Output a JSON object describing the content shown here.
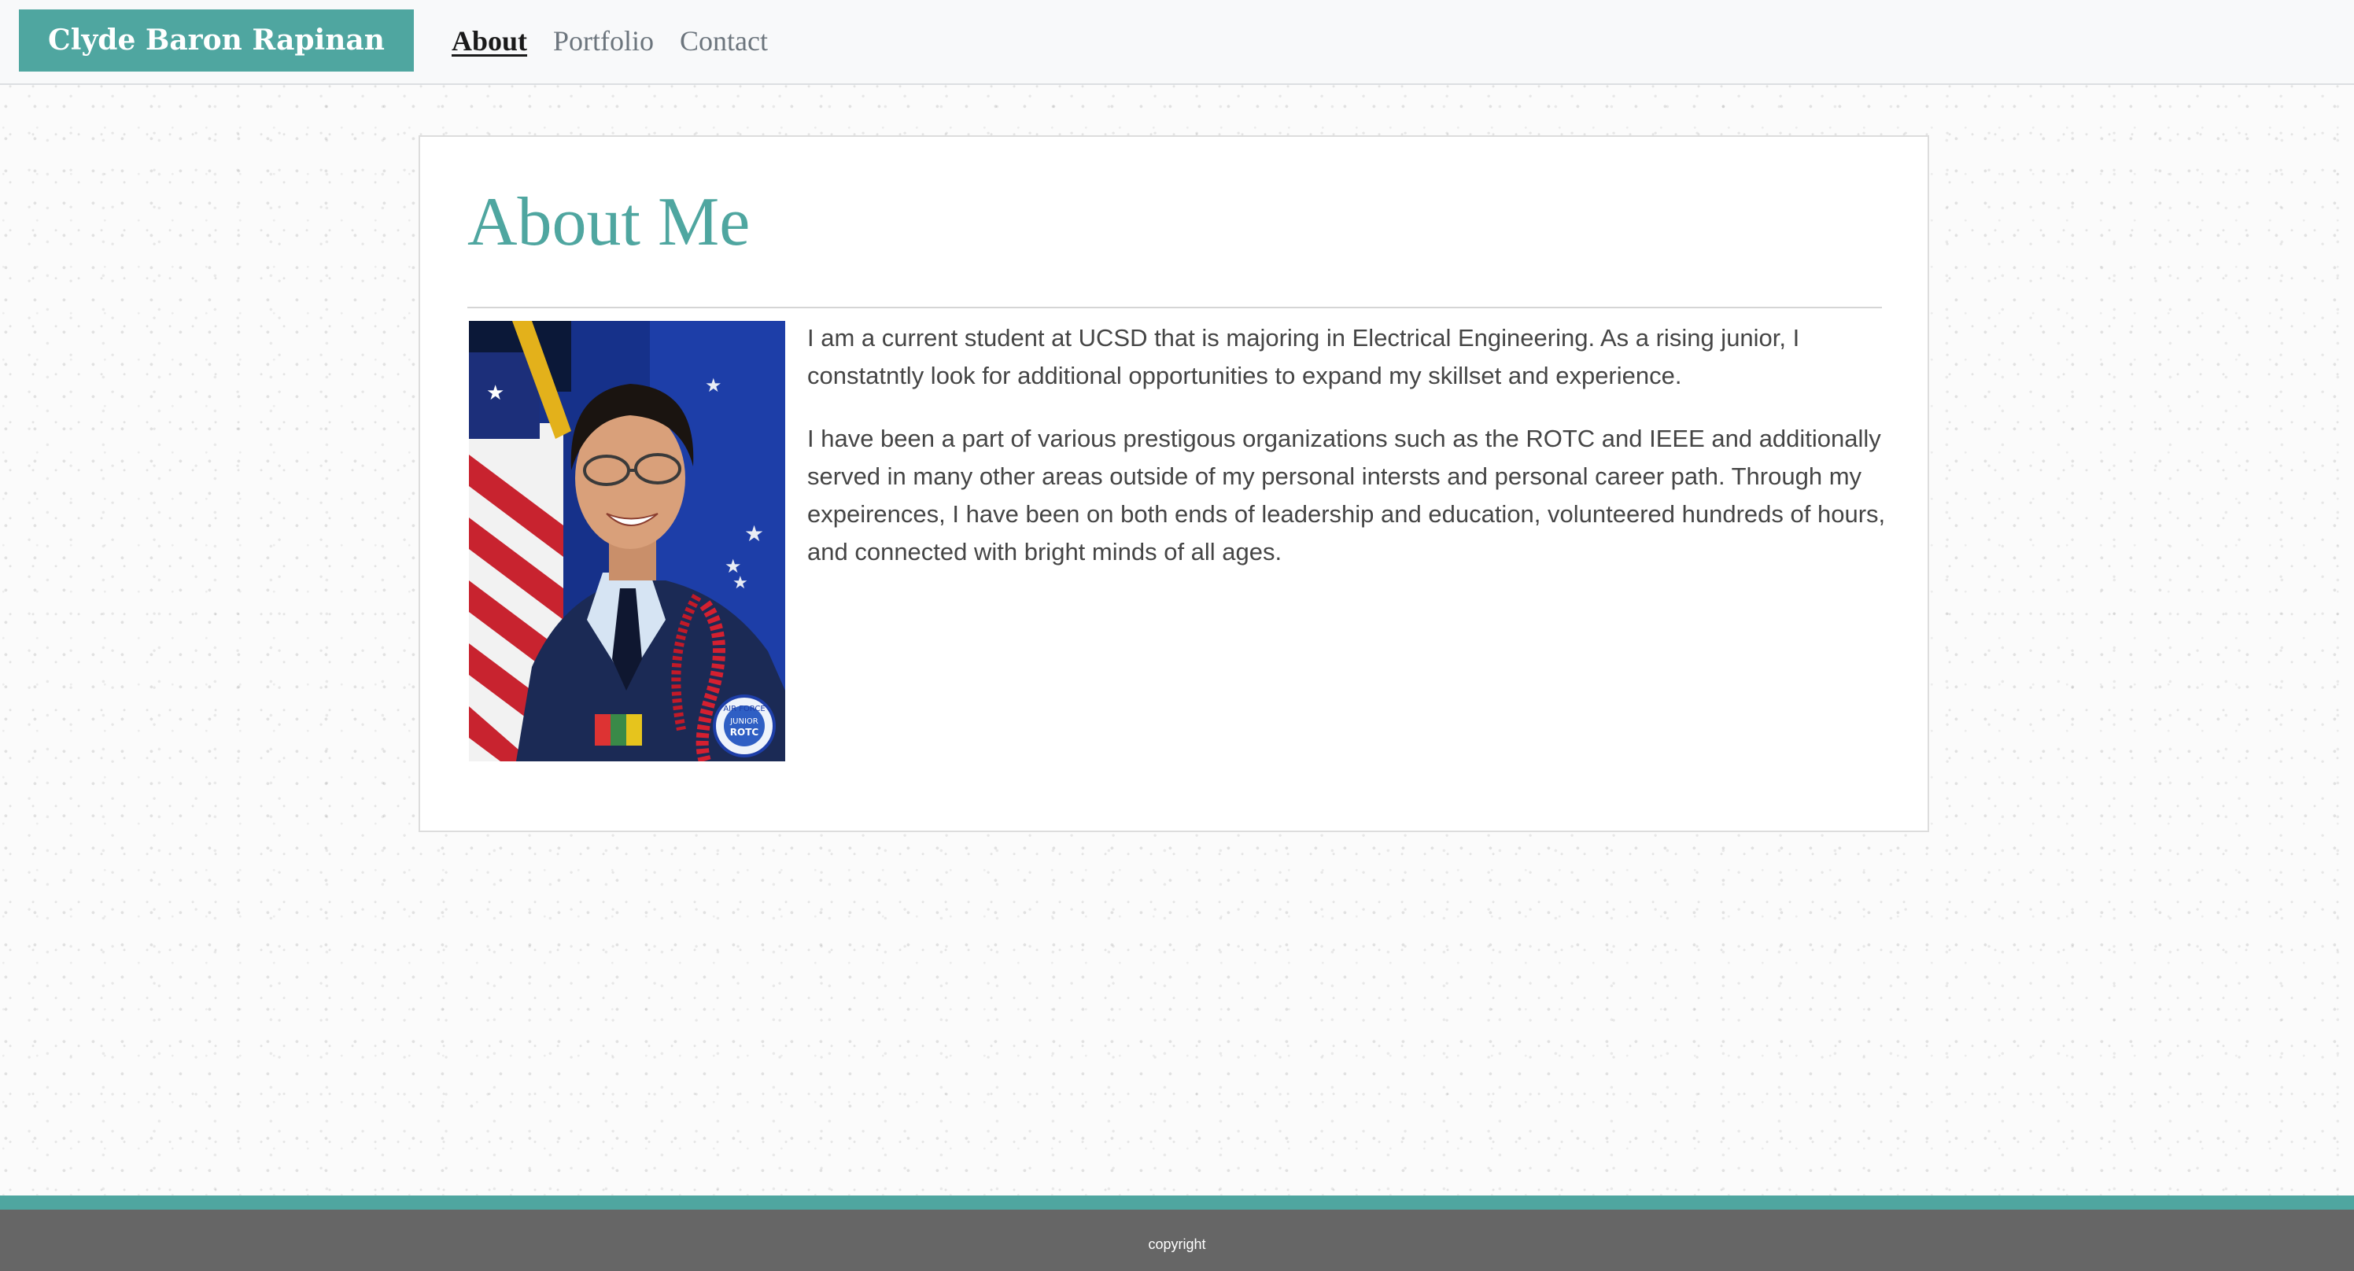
{
  "nav": {
    "brand": "Clyde Baron Rapinan",
    "links": [
      {
        "label": "About",
        "active": true
      },
      {
        "label": "Portfolio",
        "active": false
      },
      {
        "label": "Contact",
        "active": false
      }
    ]
  },
  "about": {
    "title": "About Me",
    "paragraphs": [
      "I am a current student at UCSD that is majoring in Electrical Engineering. As a rising junior, I constatntly look for additional opportunities to expand my skillset and experience.",
      "I have been a part of various prestigous organizations such as the ROTC and IEEE and additionally served in many other areas outside of my personal intersts and personal career path. Through my expeirences, I have been on both ends of leadership and education, volunteered hundreds of hours, and connected with bright minds of all ages."
    ],
    "photo_patch": {
      "line1": "AIR FORCE",
      "line2": "JUNIOR",
      "line3": "ROTC"
    }
  },
  "footer": {
    "text": "copyright"
  },
  "colors": {
    "accent": "#4fa6a0",
    "footer": "#666666",
    "navbar": "#f8f9fa"
  }
}
